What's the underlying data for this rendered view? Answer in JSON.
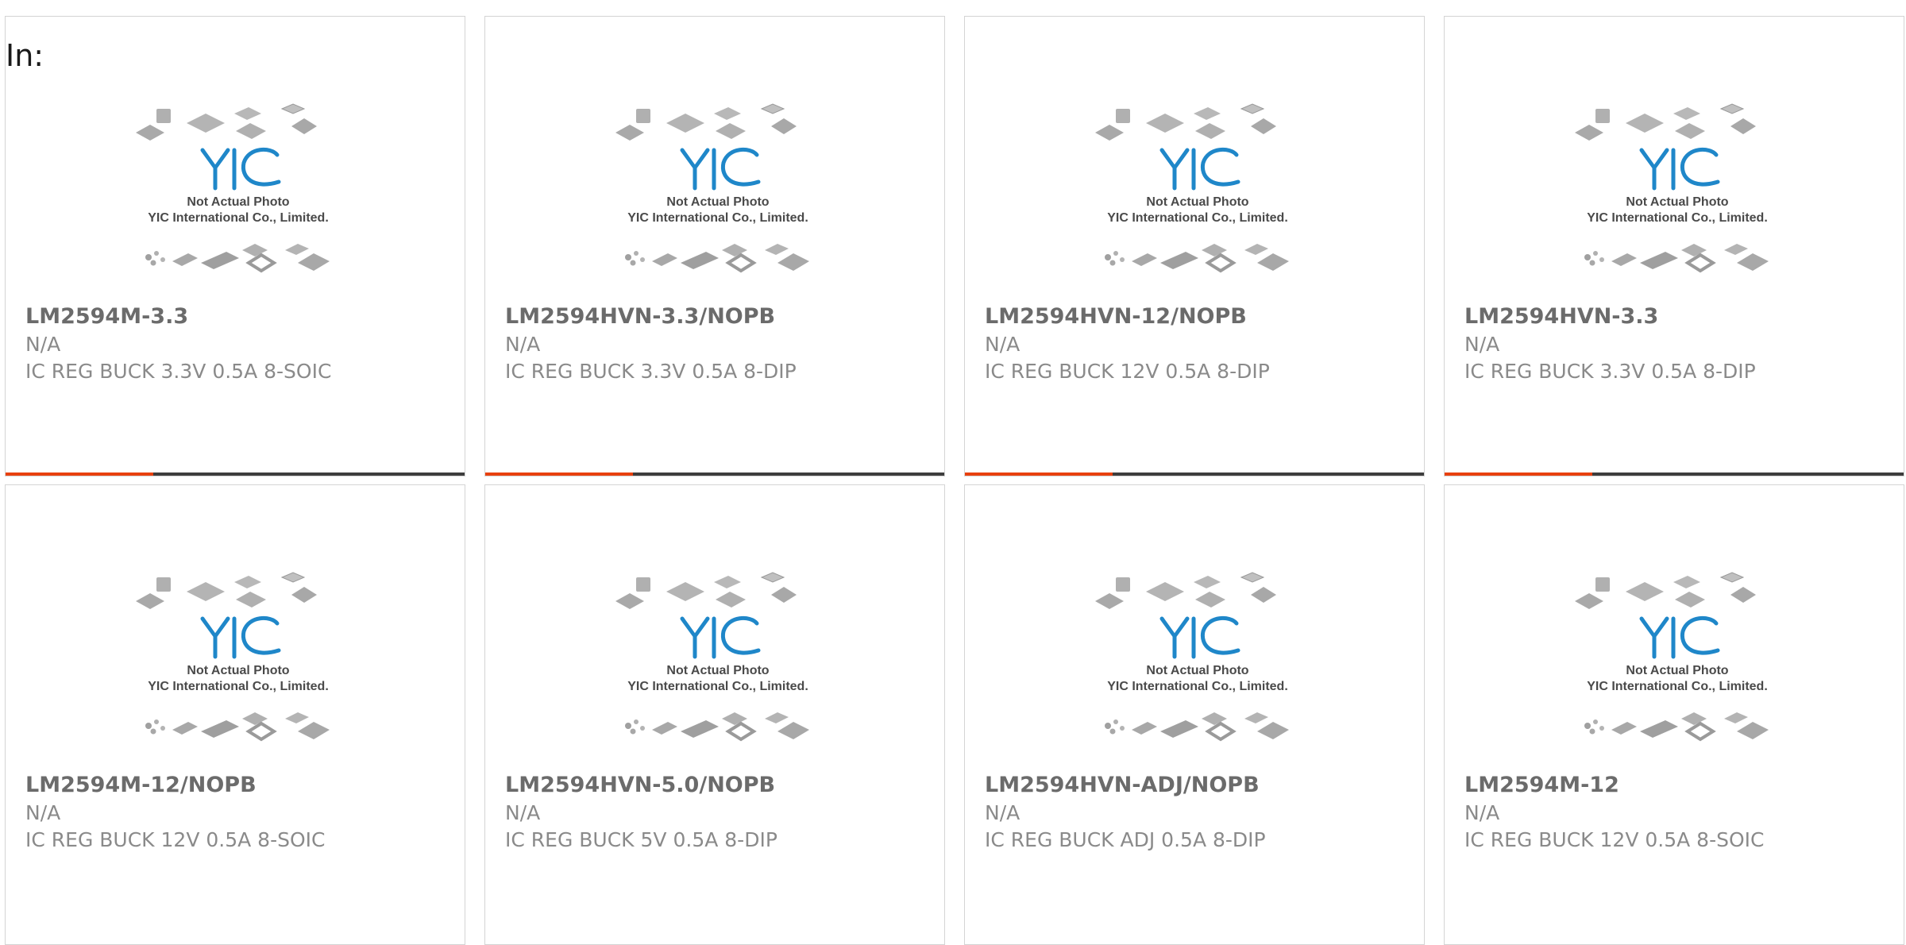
{
  "filter_label": "In:",
  "placeholder_image": {
    "line1": "Not Actual Photo",
    "line2": "YIC International Co., Limited.",
    "logo_text": "YIC"
  },
  "colors": {
    "accent": "#e8410f",
    "bar_dark": "#3d3d3d",
    "logo_blue": "#1f87c9",
    "card_border": "#d4d4d4"
  },
  "products": [
    {
      "name": "LM2594M-3.3",
      "manufacturer": "N/A",
      "description": "IC REG BUCK 3.3V 0.5A 8-SOIC",
      "bar_fill": 0.32
    },
    {
      "name": "LM2594HVN-3.3/NOPB",
      "manufacturer": "N/A",
      "description": "IC REG BUCK 3.3V 0.5A 8-DIP",
      "bar_fill": 0.32
    },
    {
      "name": "LM2594HVN-12/NOPB",
      "manufacturer": "N/A",
      "description": "IC REG BUCK 12V 0.5A 8-DIP",
      "bar_fill": 0.32
    },
    {
      "name": "LM2594HVN-3.3",
      "manufacturer": "N/A",
      "description": "IC REG BUCK 3.3V 0.5A 8-DIP",
      "bar_fill": 0.32
    },
    {
      "name": "LM2594M-12/NOPB",
      "manufacturer": "N/A",
      "description": "IC REG BUCK 12V 0.5A 8-SOIC"
    },
    {
      "name": "LM2594HVN-5.0/NOPB",
      "manufacturer": "N/A",
      "description": "IC REG BUCK 5V 0.5A 8-DIP"
    },
    {
      "name": "LM2594HVN-ADJ/NOPB",
      "manufacturer": "N/A",
      "description": "IC REG BUCK ADJ 0.5A 8-DIP"
    },
    {
      "name": "LM2594M-12",
      "manufacturer": "N/A",
      "description": "IC REG BUCK 12V 0.5A 8-SOIC"
    }
  ]
}
